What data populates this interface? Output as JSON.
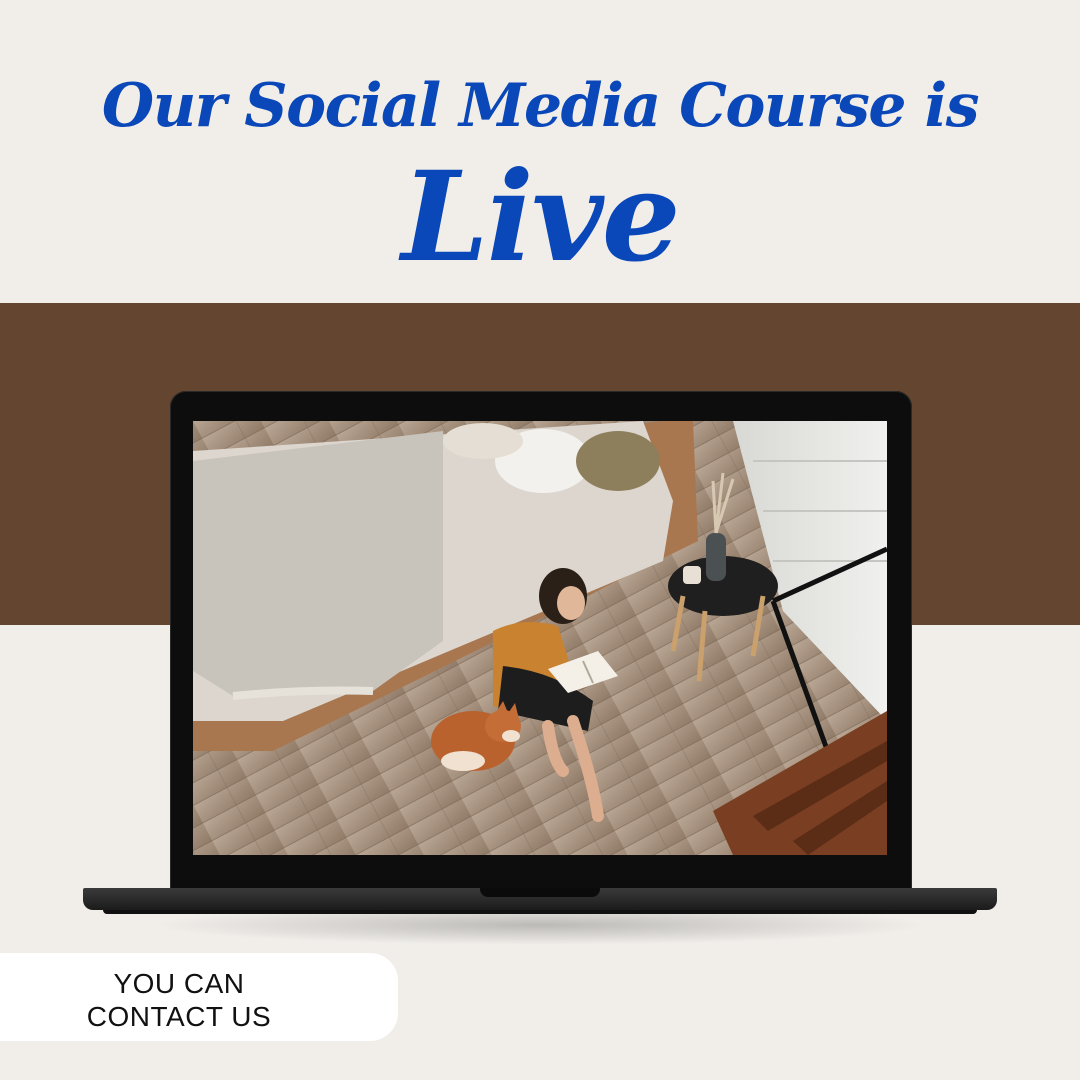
{
  "headline": {
    "line1": "Our Social Media Course is",
    "line2": "Live"
  },
  "contact": {
    "line1": "YOU CAN",
    "line2": "CONTACT US"
  },
  "colors": {
    "background": "#f1eeea",
    "band": "#634530",
    "headline": "#0a47b8",
    "laptop": "#0d0d0d",
    "pill": "#ffffff",
    "pill_text": "#111111"
  },
  "photo": {
    "subject": "woman reading a book on the floor beside a bed with a shiba inu dog"
  }
}
